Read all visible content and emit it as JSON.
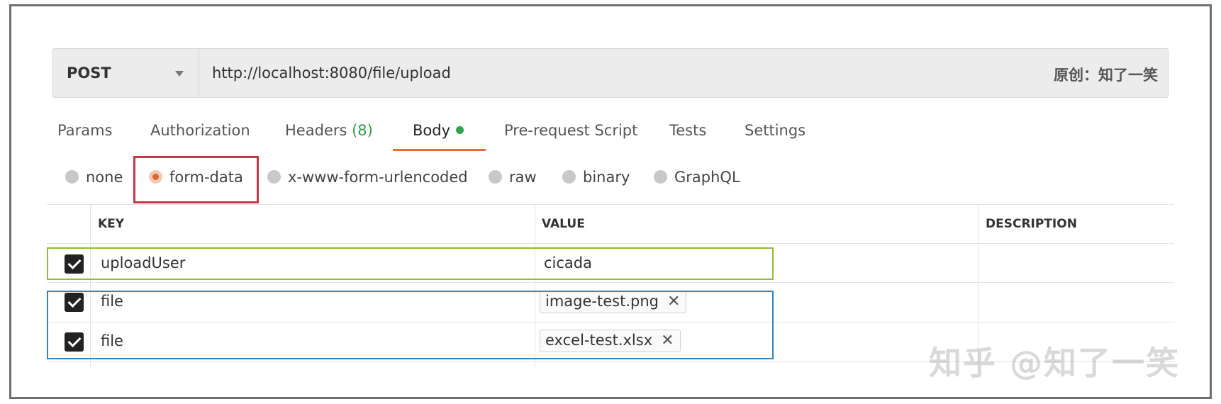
{
  "request": {
    "method": "POST",
    "url": "http://localhost:8080/file/upload",
    "credit": "原创：知了一笑"
  },
  "tabs": [
    {
      "label": "Params"
    },
    {
      "label": "Authorization"
    },
    {
      "label": "Headers",
      "count": "(8)"
    },
    {
      "label": "Body",
      "active": true
    },
    {
      "label": "Pre-request Script"
    },
    {
      "label": "Tests"
    },
    {
      "label": "Settings"
    }
  ],
  "body_types": [
    {
      "label": "none"
    },
    {
      "label": "form-data",
      "selected": true
    },
    {
      "label": "x-www-form-urlencoded"
    },
    {
      "label": "raw"
    },
    {
      "label": "binary"
    },
    {
      "label": "GraphQL"
    }
  ],
  "table": {
    "headers": {
      "key": "KEY",
      "value": "VALUE",
      "description": "DESCRIPTION"
    },
    "rows": [
      {
        "checked": true,
        "key": "uploadUser",
        "value": "cicada",
        "value_type": "text"
      },
      {
        "checked": true,
        "key": "file",
        "value": "image-test.png",
        "value_type": "file"
      },
      {
        "checked": true,
        "key": "file",
        "value": "excel-test.xlsx",
        "value_type": "file"
      }
    ]
  },
  "watermark": "知乎 @知了一笑",
  "colors": {
    "accent": "#e2703a",
    "body_dot": "#2fa44f",
    "highlight_red": "#c8374a",
    "highlight_green": "#8fbc3b",
    "highlight_blue": "#2f86c6"
  },
  "icons": {
    "method_dropdown": "chevron-down-icon",
    "remove_file": "close-icon",
    "checkbox": "checkbox-checked-icon"
  }
}
